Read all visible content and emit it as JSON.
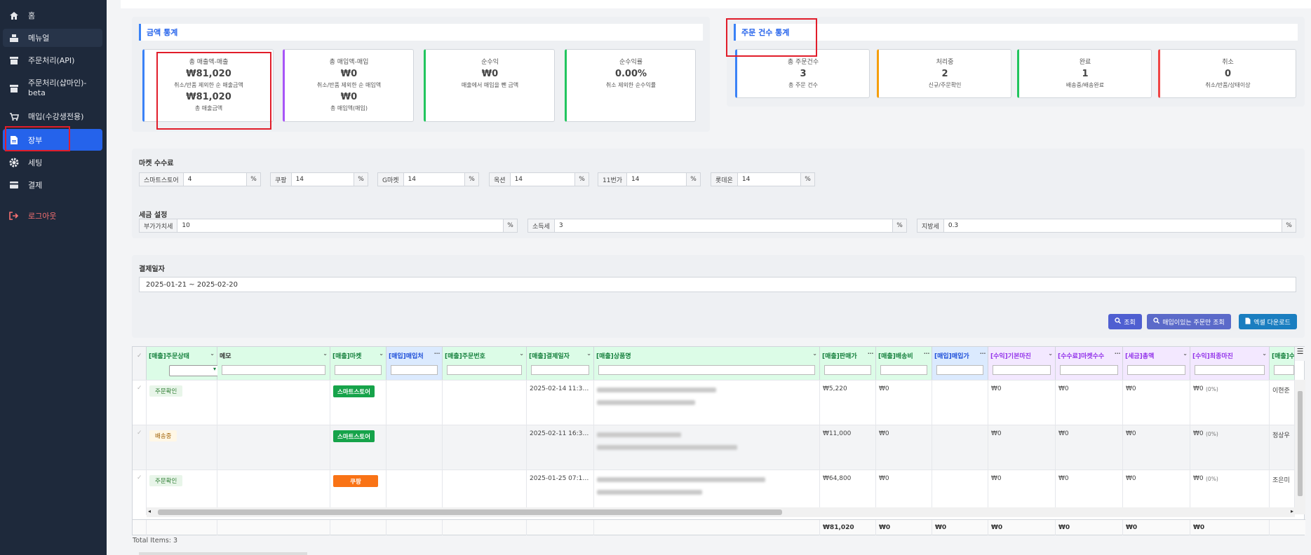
{
  "sidebar": {
    "items": [
      {
        "label": "홈",
        "icon": "home-icon"
      },
      {
        "label": "메뉴얼",
        "icon": "manual-icon"
      },
      {
        "label": "주문처리(API)",
        "icon": "store-icon"
      },
      {
        "label": "주문처리(샵마인)-beta",
        "icon": "store-icon"
      },
      {
        "label": "매입(수강생전용)",
        "icon": "cart-icon"
      },
      {
        "label": "장부",
        "icon": "file-icon"
      },
      {
        "label": "세팅",
        "icon": "gear-icon"
      },
      {
        "label": "결제",
        "icon": "card-icon"
      },
      {
        "label": "로그아웃",
        "icon": "logout-icon"
      }
    ]
  },
  "amount_stats": {
    "title": "금액 통계",
    "cards": [
      {
        "label": "총 매출액-매출",
        "value": "₩81,020",
        "sub": "취소/반품 제외한 순 매출금액",
        "value2": "₩81,020",
        "sub2": "총 매출금액",
        "color": "#3b82f6"
      },
      {
        "label": "총 매입액-매입",
        "value": "₩0",
        "sub": "취소/반품 제외한 순 매입액",
        "value2": "₩0",
        "sub2": "총 매입액(매입)",
        "color": "#a855f7"
      },
      {
        "label": "순수익",
        "value": "₩0",
        "sub": "매출에서 매입을 뺀 금액",
        "color": "#22c55e"
      },
      {
        "label": "순수익률",
        "value": "0.00%",
        "sub": "취소 제외한 순수익률",
        "color": "#22c55e"
      }
    ]
  },
  "order_stats": {
    "title": "주문 건수 통계",
    "cards": [
      {
        "label": "총 주문건수",
        "value": "3",
        "sub": "총 주문 건수",
        "color": "#3b82f6"
      },
      {
        "label": "처리중",
        "value": "2",
        "sub": "신규/주문확인",
        "color": "#f59e0b"
      },
      {
        "label": "완료",
        "value": "1",
        "sub": "배송중/배송완료",
        "color": "#22c55e"
      },
      {
        "label": "취소",
        "value": "0",
        "sub": "취소/반품/상태이상",
        "color": "#ef4444"
      }
    ]
  },
  "market_fees": {
    "title": "마켓 수수료",
    "items": [
      {
        "name": "스마트스토어",
        "value": "4",
        "unit": "%"
      },
      {
        "name": "쿠팡",
        "value": "14",
        "unit": "%"
      },
      {
        "name": "G마켓",
        "value": "14",
        "unit": "%"
      },
      {
        "name": "옥션",
        "value": "14",
        "unit": "%"
      },
      {
        "name": "11번가",
        "value": "14",
        "unit": "%"
      },
      {
        "name": "롯데온",
        "value": "14",
        "unit": "%"
      }
    ]
  },
  "tax": {
    "title": "세금 설정",
    "items": [
      {
        "name": "부가가치세",
        "value": "10",
        "unit": "%"
      },
      {
        "name": "소득세",
        "value": "3",
        "unit": "%"
      },
      {
        "name": "지방세",
        "value": "0.3",
        "unit": "%"
      }
    ]
  },
  "date_filter": {
    "title": "결제일자",
    "value": "2025-01-21 ~ 2025-02-20"
  },
  "buttons": {
    "search": "조회",
    "purchase_only": "매입이있는 주문만 조회",
    "excel": "엑셀 다운로드"
  },
  "grid": {
    "columns": [
      {
        "label": "[매출]주문상태",
        "bg": "#dcfce7"
      },
      {
        "label": "메모",
        "bg": "#dcfce7"
      },
      {
        "label": "[매출]마켓",
        "bg": "#dcfce7"
      },
      {
        "label": "[매입]매입처",
        "bg": "#dbeafe"
      },
      {
        "label": "[매출]주문번호",
        "bg": "#dcfce7"
      },
      {
        "label": "[매출]결제일자",
        "bg": "#dcfce7"
      },
      {
        "label": "[매출]상품명",
        "bg": "#dcfce7"
      },
      {
        "label": "[매출]판매가",
        "bg": "#dcfce7"
      },
      {
        "label": "[매출]배송비",
        "bg": "#dcfce7"
      },
      {
        "label": "[매입]매입가",
        "bg": "#dbeafe"
      },
      {
        "label": "[수익]기본마진",
        "bg": "#f3e8ff"
      },
      {
        "label": "[수수료]마켓수수",
        "bg": "#f3e8ff"
      },
      {
        "label": "[세금]총액",
        "bg": "#f3e8ff"
      },
      {
        "label": "[수익]최종마진",
        "bg": "#f3e8ff"
      },
      {
        "label": "[매출]수",
        "bg": "#dcfce7"
      }
    ],
    "rows": [
      {
        "status": "주문확인",
        "market": "스마트스토어",
        "market_color": "#16a34a",
        "date": "2025-02-14 11:3…",
        "price": "₩5,220",
        "ship": "₩0",
        "basic": "₩0",
        "fee": "₩0",
        "tax": "₩0",
        "final": "₩0",
        "final_pct": "(0%)",
        "buyer": "이현준"
      },
      {
        "status": "배송중",
        "market": "스마트스토어",
        "market_color": "#16a34a",
        "date": "2025-02-11 16:3…",
        "price": "₩11,000",
        "ship": "₩0",
        "basic": "₩0",
        "fee": "₩0",
        "tax": "₩0",
        "final": "₩0",
        "final_pct": "(0%)",
        "buyer": "정상우"
      },
      {
        "status": "주문확인",
        "market": "쿠팡",
        "market_color": "#f97316",
        "date": "2025-01-25 07:1…",
        "price": "₩64,800",
        "ship": "₩0",
        "basic": "₩0",
        "fee": "₩0",
        "tax": "₩0",
        "final": "₩0",
        "final_pct": "(0%)",
        "buyer": "조은미"
      }
    ],
    "totals": {
      "price": "₩81,020",
      "ship": "₩0",
      "purchase": "₩0",
      "basic": "₩0",
      "fee": "₩0",
      "tax": "₩0",
      "final": "₩0"
    },
    "total_items": "Total Items: 3"
  }
}
